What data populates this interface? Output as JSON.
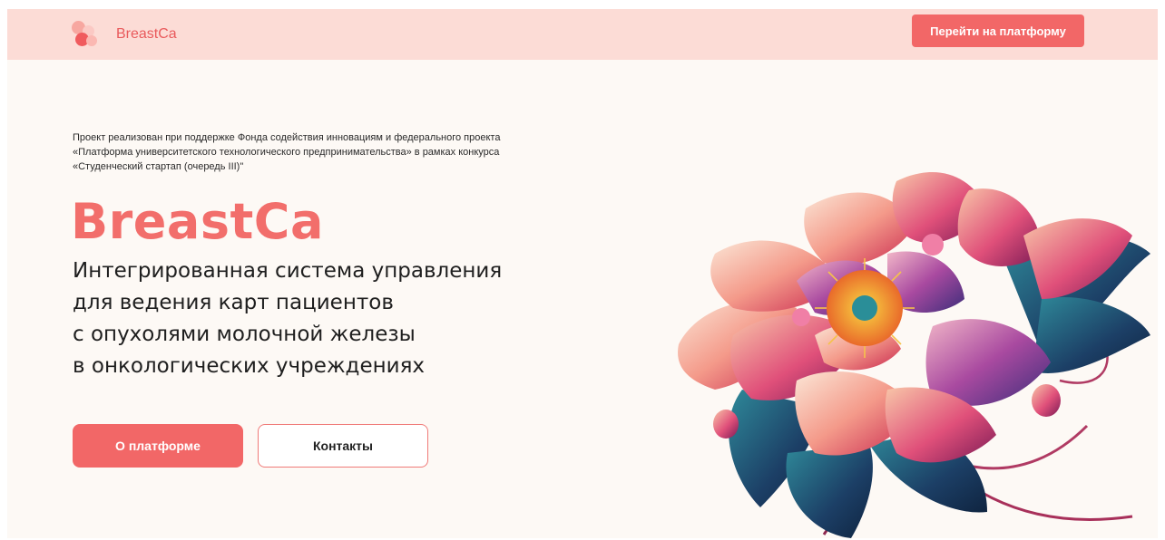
{
  "header": {
    "brand_name": "BreastCa",
    "cta_label": "Перейти на платформу"
  },
  "hero": {
    "support_lines": [
      "Проект реализован при поддержке Фонда содействия инновациям и федерального проекта",
      "«Платформа университетского технологического предпринимательства» в рамках конкурса",
      "«Студенческий стартап (очередь III)\""
    ],
    "title": "BreastCa",
    "subtitle_lines": [
      "Интегрированная система управления",
      "для ведения карт пациентов",
      "с опухолями молочной железы",
      "в онкологических учреждениях"
    ],
    "primary_button": "О платформе",
    "secondary_button": "Контакты"
  },
  "colors": {
    "accent": "#f26767",
    "brand_text": "#e95a5c",
    "header_bg": "#fcdcd6",
    "page_bg": "#fdf9f5"
  },
  "icons": {
    "logo": "brand-logo-dots",
    "hero_image": "lotus-flower-illustration"
  }
}
